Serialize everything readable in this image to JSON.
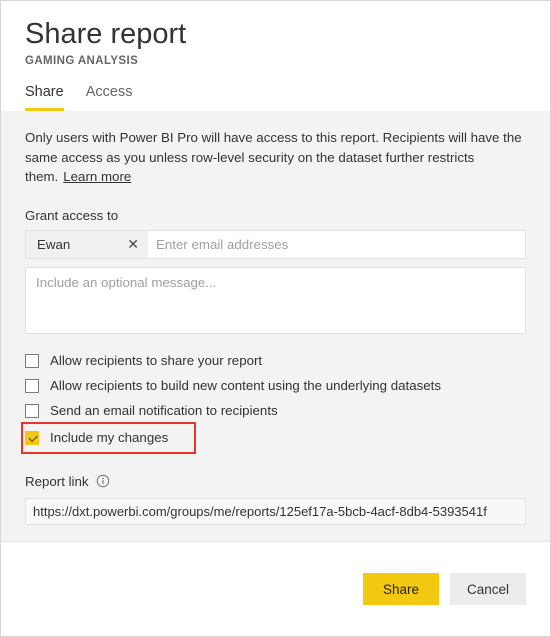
{
  "dialog": {
    "title": "Share report",
    "subtitle": "GAMING ANALYSIS"
  },
  "tabs": [
    {
      "label": "Share",
      "active": true
    },
    {
      "label": "Access",
      "active": false
    }
  ],
  "description": {
    "text": "Only users with Power BI Pro will have access to this report. Recipients will have the same access as you unless row-level security on the dataset further restricts them.",
    "link_label": "Learn more"
  },
  "grant_access": {
    "label": "Grant access to",
    "chips": [
      {
        "label": "Ewan",
        "remove_icon": "close-icon"
      }
    ],
    "input_placeholder": "Enter email addresses",
    "input_value": ""
  },
  "message": {
    "placeholder": "Include an optional message...",
    "value": ""
  },
  "options": [
    {
      "label": "Allow recipients to share your report",
      "checked": false,
      "highlighted": false
    },
    {
      "label": "Allow recipients to build new content using the underlying datasets",
      "checked": false,
      "highlighted": false
    },
    {
      "label": "Send an email notification to recipients",
      "checked": false,
      "highlighted": false
    },
    {
      "label": "Include my changes",
      "checked": true,
      "highlighted": true
    }
  ],
  "report_link": {
    "label": "Report link",
    "info_icon": "info-icon",
    "url": "https://dxt.powerbi.com/groups/me/reports/125ef17a-5bcb-4acf-8db4-5393541f"
  },
  "footer": {
    "primary_label": "Share",
    "secondary_label": "Cancel"
  },
  "colors": {
    "accent": "#f2c811",
    "highlight_box": "#e8352a",
    "body_background": "#f3f3f3",
    "panel_background": "#ffffff"
  }
}
